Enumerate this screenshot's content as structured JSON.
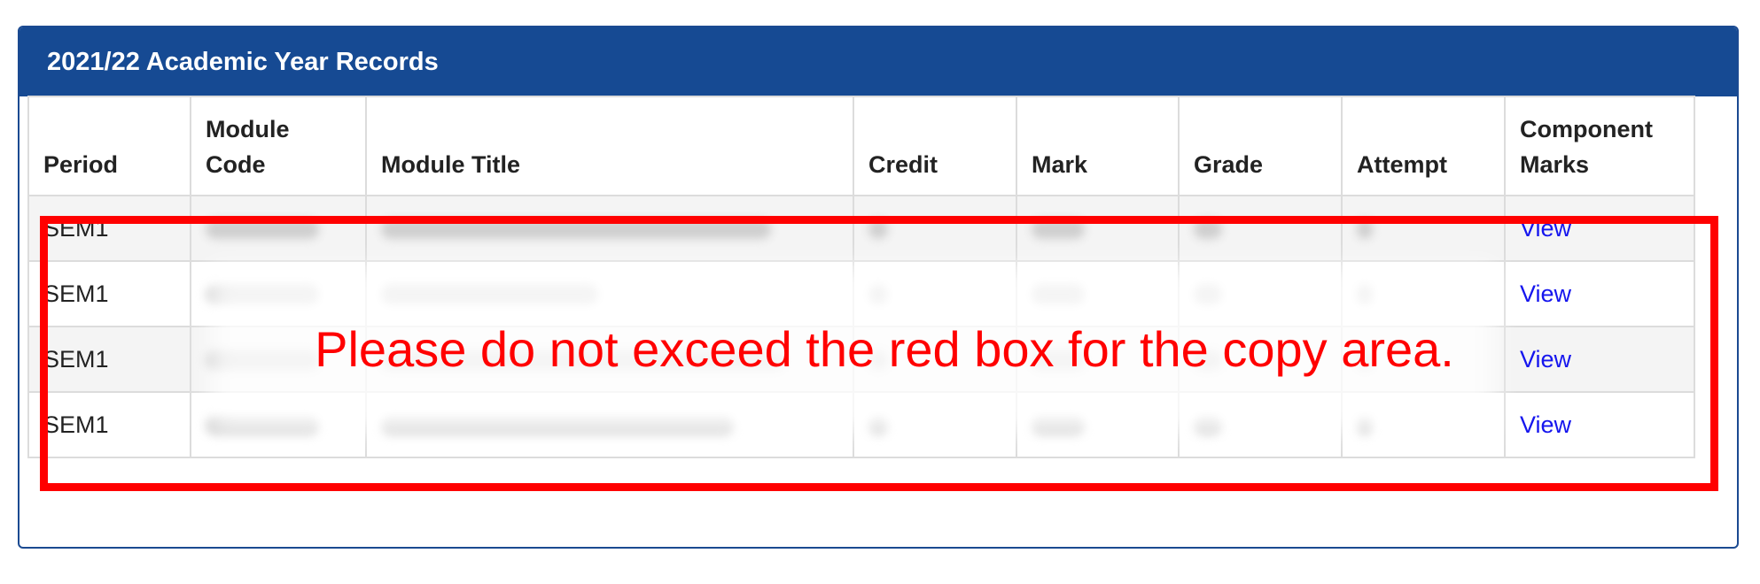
{
  "panel": {
    "title": "2021/22 Academic Year Records"
  },
  "table": {
    "columns": [
      {
        "line1": "Period",
        "line2": ""
      },
      {
        "line1": "Module",
        "line2": "Code"
      },
      {
        "line1": "Module Title",
        "line2": ""
      },
      {
        "line1": "Credit",
        "line2": ""
      },
      {
        "line1": "Mark",
        "line2": ""
      },
      {
        "line1": "Grade",
        "line2": ""
      },
      {
        "line1": "Attempt",
        "line2": ""
      },
      {
        "line1": "Component",
        "line2": "Marks"
      }
    ],
    "rows": [
      {
        "period": "SEM1",
        "component_marks": "View"
      },
      {
        "period": "SEM1",
        "component_marks": "View"
      },
      {
        "period": "SEM1",
        "component_marks": "View"
      },
      {
        "period": "SEM1",
        "component_marks": "View"
      }
    ]
  },
  "overlay": {
    "message": "Please do not exceed the red box for the copy area.",
    "box_color": "#ff0000"
  },
  "colors": {
    "header_bg": "#164a93",
    "link": "#1515ee"
  }
}
